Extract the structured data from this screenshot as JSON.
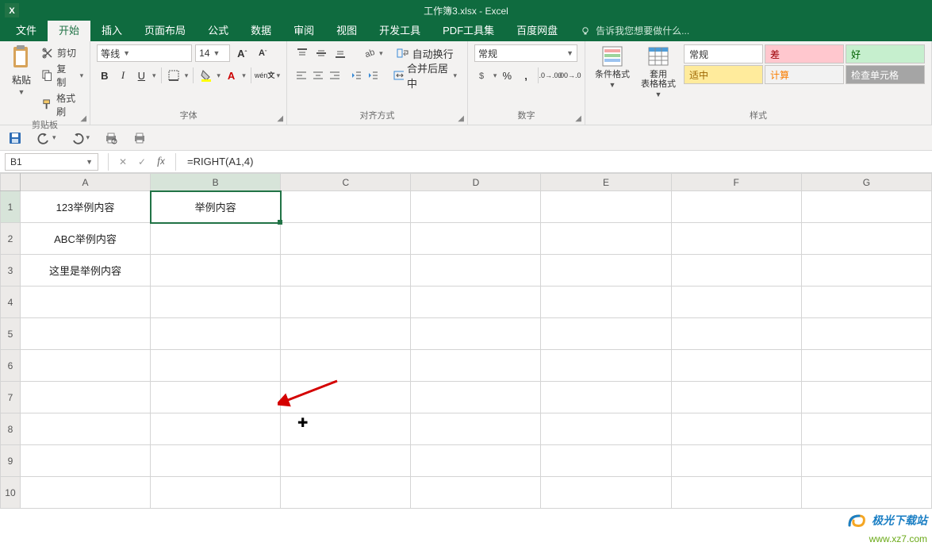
{
  "title": "工作簿3.xlsx - Excel",
  "tellme_placeholder": "告诉我您想要做什么...",
  "tabs": [
    "文件",
    "开始",
    "插入",
    "页面布局",
    "公式",
    "数据",
    "审阅",
    "视图",
    "开发工具",
    "PDF工具集",
    "百度网盘"
  ],
  "active_tab_index": 1,
  "groups": {
    "clipboard": {
      "label": "剪贴板",
      "paste": "粘贴",
      "cut": "剪切",
      "copy": "复制",
      "format_painter": "格式刷"
    },
    "font": {
      "label": "字体",
      "name": "等线",
      "size": "14",
      "grow": "A",
      "shrink": "A",
      "bold": "B",
      "italic": "I",
      "underline": "U",
      "ruby": "wén"
    },
    "alignment": {
      "label": "对齐方式",
      "wrap": "自动换行",
      "merge": "合并后居中"
    },
    "number": {
      "label": "数字",
      "format": "常规"
    },
    "styles": {
      "label": "样式",
      "cond_format": "条件格式",
      "table_format": "套用\n表格格式",
      "cells": [
        {
          "text": "常规",
          "bg": "#ffffff",
          "fg": "#333"
        },
        {
          "text": "差",
          "bg": "#ffc7ce",
          "fg": "#9c0006"
        },
        {
          "text": "好",
          "bg": "#c6efce",
          "fg": "#006100"
        },
        {
          "text": "适中",
          "bg": "#ffeb9c",
          "fg": "#9c6500"
        },
        {
          "text": "计算",
          "bg": "#f2f2f2",
          "fg": "#fa7d00"
        },
        {
          "text": "检查单元格",
          "bg": "#a5a5a5",
          "fg": "#ffffff"
        }
      ]
    }
  },
  "namebox": "B1",
  "formula": "=RIGHT(A1,4)",
  "columns": [
    "A",
    "B",
    "C",
    "D",
    "E",
    "F",
    "G"
  ],
  "rows": [
    "1",
    "2",
    "3",
    "4",
    "5",
    "6",
    "7",
    "8",
    "9",
    "10"
  ],
  "cells": {
    "A1": "123举例内容",
    "B1": "举例内容",
    "A2": "ABC举例内容",
    "A3": "这里是举例内容"
  },
  "selected": "B1",
  "watermark": {
    "l1": "极光下载站",
    "l2": "www.xz7.com"
  }
}
